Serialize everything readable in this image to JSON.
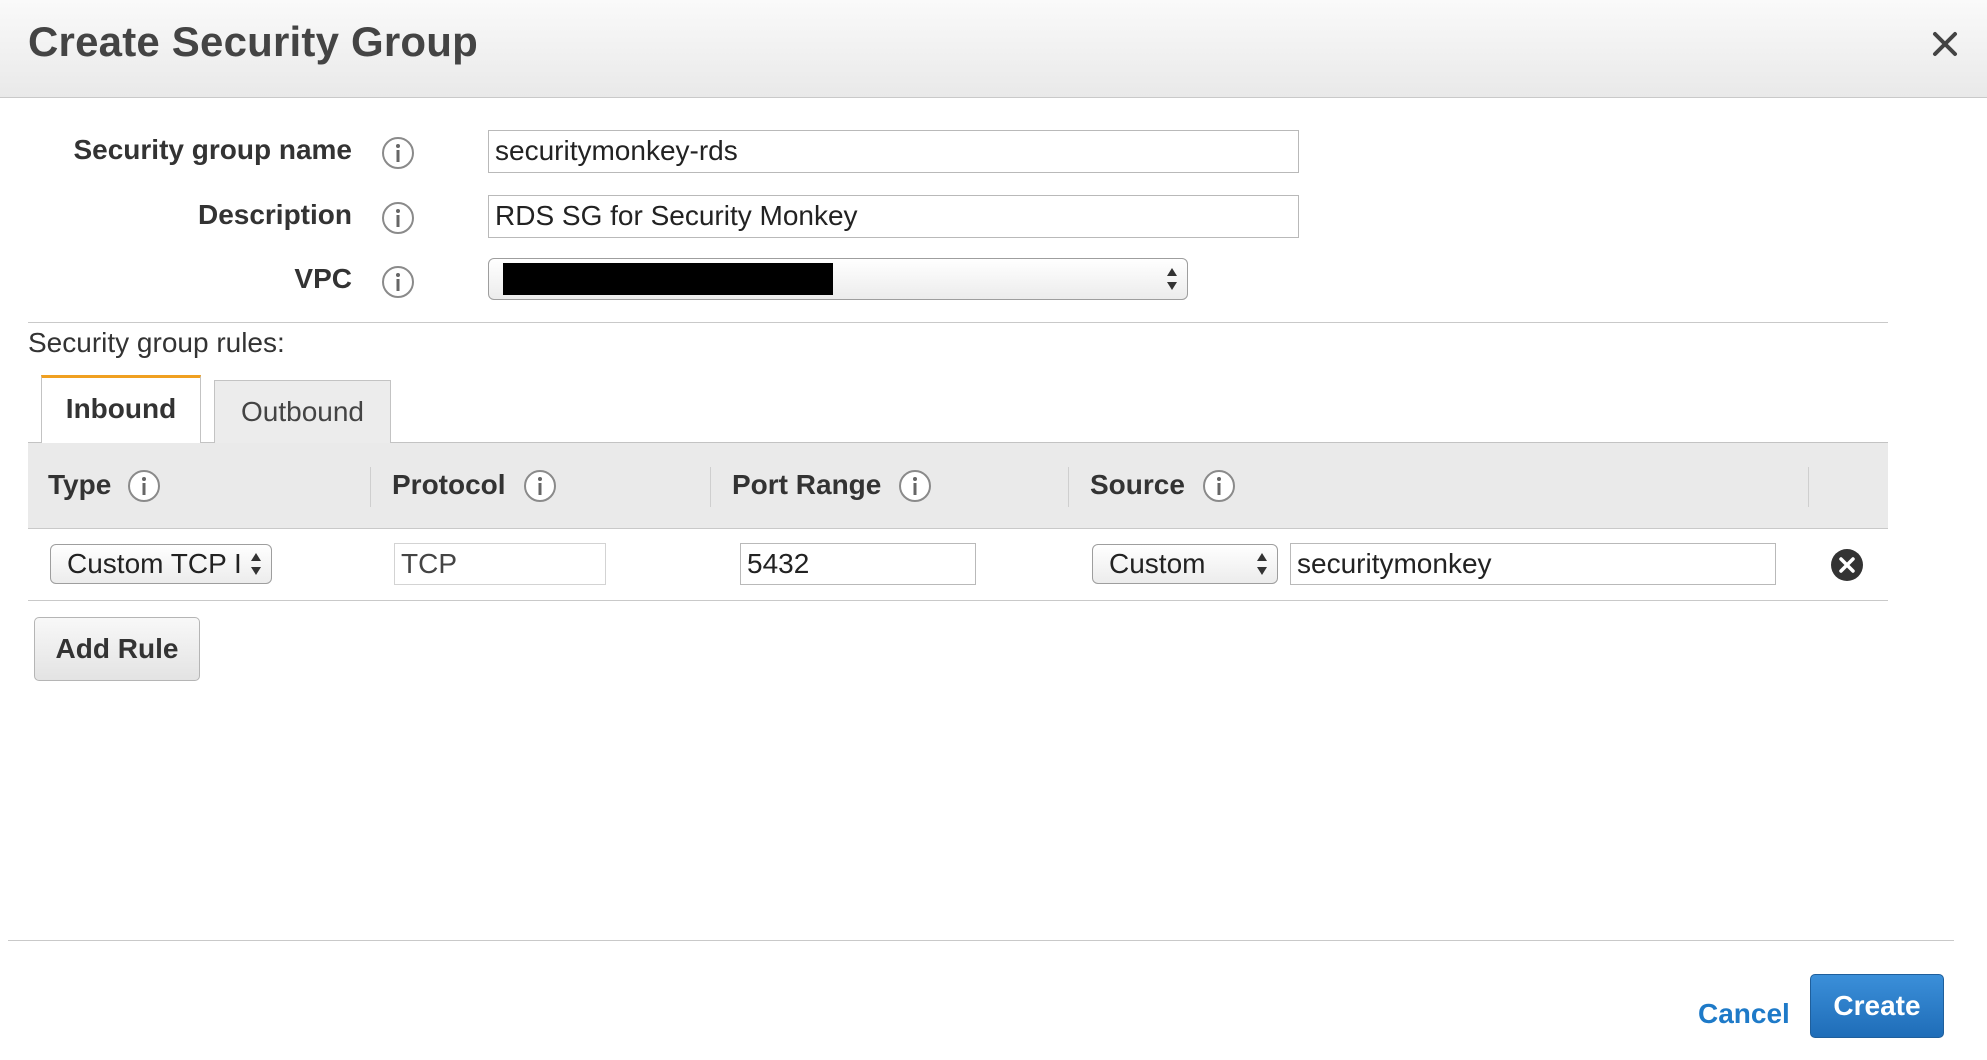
{
  "dialog": {
    "title": "Create Security Group"
  },
  "form": {
    "name_label": "Security group name",
    "name_value": "securitymonkey-rds",
    "description_label": "Description",
    "description_value": "RDS SG for Security Monkey",
    "vpc_label": "VPC"
  },
  "rules": {
    "section_label": "Security group rules:",
    "tabs": [
      {
        "label": "Inbound",
        "active": true
      },
      {
        "label": "Outbound",
        "active": false
      }
    ],
    "columns": [
      "Type",
      "Protocol",
      "Port Range",
      "Source"
    ],
    "rows": [
      {
        "type": "Custom TCP I",
        "protocol": "TCP",
        "port_range": "5432",
        "source_mode": "Custom",
        "source_value": "securitymonkey"
      }
    ],
    "add_rule_label": "Add Rule"
  },
  "footer": {
    "cancel_label": "Cancel",
    "create_label": "Create"
  },
  "colors": {
    "accent_tab": "#f0a020",
    "primary_button": "#1f6db8",
    "link": "#1e7ac8"
  },
  "icons": [
    "close-icon",
    "info-icon",
    "select-arrows-icon",
    "remove-circle-icon"
  ]
}
